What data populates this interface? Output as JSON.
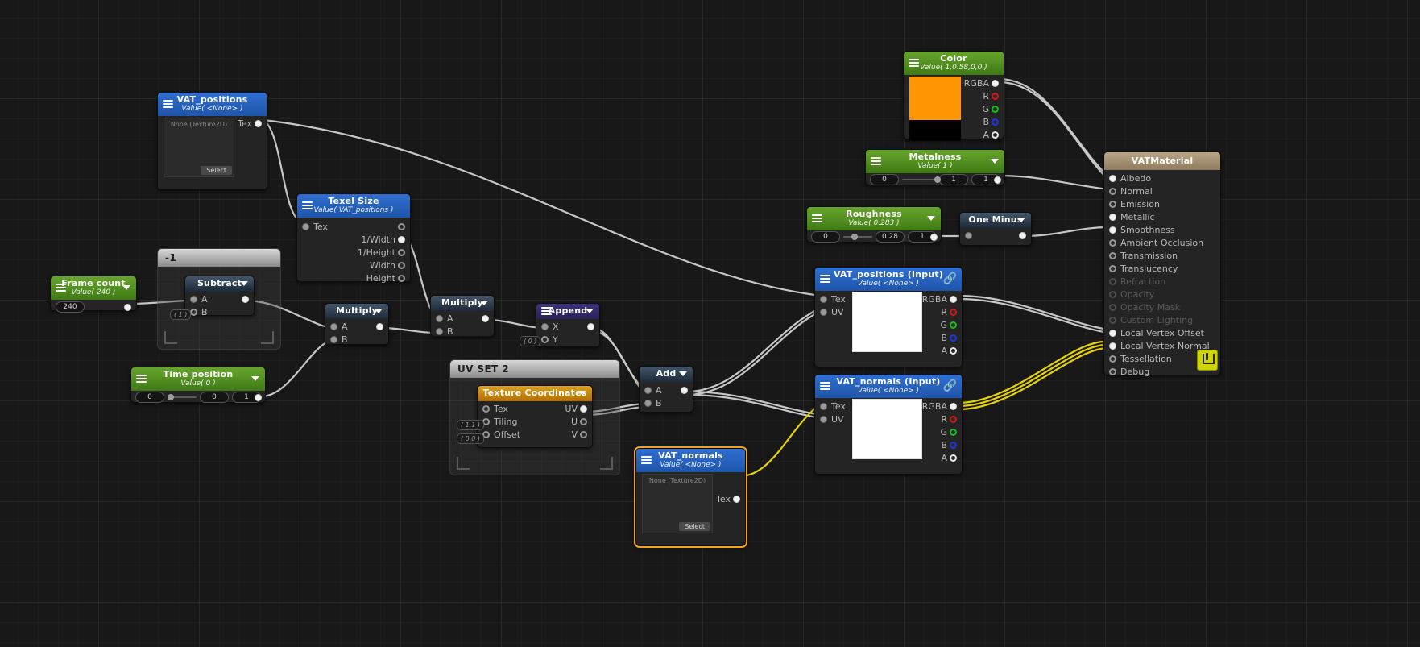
{
  "app": {
    "editor": "shader-node-graph"
  },
  "nodes": {
    "vat_positions": {
      "title": "VAT_positions",
      "subtitle": "Value( <None> )",
      "tex_placeholder": "None (Texture2D)",
      "select_label": "Select",
      "out_label": "Tex",
      "header_color": "#2f6fd0"
    },
    "texel_size": {
      "title": "Texel Size",
      "subtitle": "Value( VAT_positions )",
      "in_label": "Tex",
      "outputs": [
        "1/Width",
        "1/Height",
        "Width",
        "Height"
      ],
      "header_color": "#2f6fd0"
    },
    "frame_count": {
      "title": "Frame count",
      "subtitle": "Value( 240 )",
      "value": "240",
      "header_color": "#67a52c"
    },
    "time_position": {
      "title": "Time position",
      "subtitle": "Value( 0 )",
      "value_min": "0",
      "value": "0",
      "value_max": "1",
      "header_color": "#67a52c"
    },
    "subtract": {
      "title": "Subtract",
      "inputs": [
        "A",
        "B"
      ],
      "b_default": "( 1 )",
      "header_color": "#44566a"
    },
    "multiply_1": {
      "title": "Multiply",
      "inputs": [
        "A",
        "B"
      ],
      "header_color": "#44566a"
    },
    "multiply_2": {
      "title": "Multiply",
      "inputs": [
        "A",
        "B"
      ],
      "header_color": "#44566a"
    },
    "append": {
      "title": "Append",
      "inputs": [
        "X",
        "Y"
      ],
      "y_default": "( 0 )",
      "header_color": "#3b337e"
    },
    "add": {
      "title": "Add",
      "inputs": [
        "A",
        "B"
      ],
      "header_color": "#44566a"
    },
    "texture_coordinates": {
      "title": "Texture Coordinates",
      "inputs": [
        "Tex",
        "Tiling",
        "Offset"
      ],
      "outputs": [
        "UV",
        "U",
        "V"
      ],
      "tiling_default": "( 1,1 )",
      "offset_default": "( 0,0 )",
      "header_color": "#e0a01a"
    },
    "vat_normals": {
      "title": "VAT_normals",
      "subtitle": "Value( <None> )",
      "tex_placeholder": "None (Texture2D)",
      "select_label": "Select",
      "out_label": "Tex",
      "header_color": "#2f6fd0",
      "selected": true
    },
    "color": {
      "title": "Color",
      "subtitle": "Value( 1,0.58,0,0 )",
      "swatch_hex": "#ff9500",
      "outputs": [
        "RGBA",
        "R",
        "G",
        "B",
        "A"
      ],
      "header_color": "#67a52c"
    },
    "metalness": {
      "title": "Metalness",
      "subtitle": "Value( 1 )",
      "value_min": "0",
      "value": "1",
      "value_max": "1",
      "header_color": "#67a52c"
    },
    "roughness": {
      "title": "Roughness",
      "subtitle": "Value( 0.283 )",
      "value_min": "0",
      "value": "0.28",
      "value_max": "1",
      "header_color": "#67a52c"
    },
    "one_minus": {
      "title": "One Minus",
      "header_color": "#44566a"
    },
    "vat_positions_input": {
      "title": "VAT_positions (Input)",
      "subtitle": "Value( <None> )",
      "inputs": [
        "Tex",
        "UV"
      ],
      "outputs": [
        "RGBA",
        "R",
        "G",
        "B",
        "A"
      ],
      "header_color": "#2f6fd0"
    },
    "vat_normals_input": {
      "title": "VAT_normals (Input)",
      "subtitle": "Value( <None> )",
      "inputs": [
        "Tex",
        "UV"
      ],
      "outputs": [
        "RGBA",
        "R",
        "G",
        "B",
        "A"
      ],
      "header_color": "#2f6fd0"
    },
    "vat_material": {
      "title": "VATMaterial",
      "header_color": "#b9a486",
      "inputs": [
        {
          "label": "Albedo",
          "state": "connected"
        },
        {
          "label": "Normal",
          "state": "open"
        },
        {
          "label": "Emission",
          "state": "open"
        },
        {
          "label": "Metallic",
          "state": "connected"
        },
        {
          "label": "Smoothness",
          "state": "connected"
        },
        {
          "label": "Ambient Occlusion",
          "state": "open"
        },
        {
          "label": "Transmission",
          "state": "open"
        },
        {
          "label": "Translucency",
          "state": "open"
        },
        {
          "label": "Refraction",
          "state": "disabled"
        },
        {
          "label": "Opacity",
          "state": "disabled"
        },
        {
          "label": "Opacity Mask",
          "state": "disabled"
        },
        {
          "label": "Custom Lighting",
          "state": "disabled"
        },
        {
          "label": "Local Vertex Offset",
          "state": "connected"
        },
        {
          "label": "Local Vertex Normal",
          "state": "connected"
        },
        {
          "label": "Tessellation",
          "state": "open"
        },
        {
          "label": "Debug",
          "state": "open"
        }
      ]
    }
  },
  "frames": {
    "minus_one": {
      "title": "-1"
    },
    "uv_set_2": {
      "title": "UV SET 2"
    }
  }
}
